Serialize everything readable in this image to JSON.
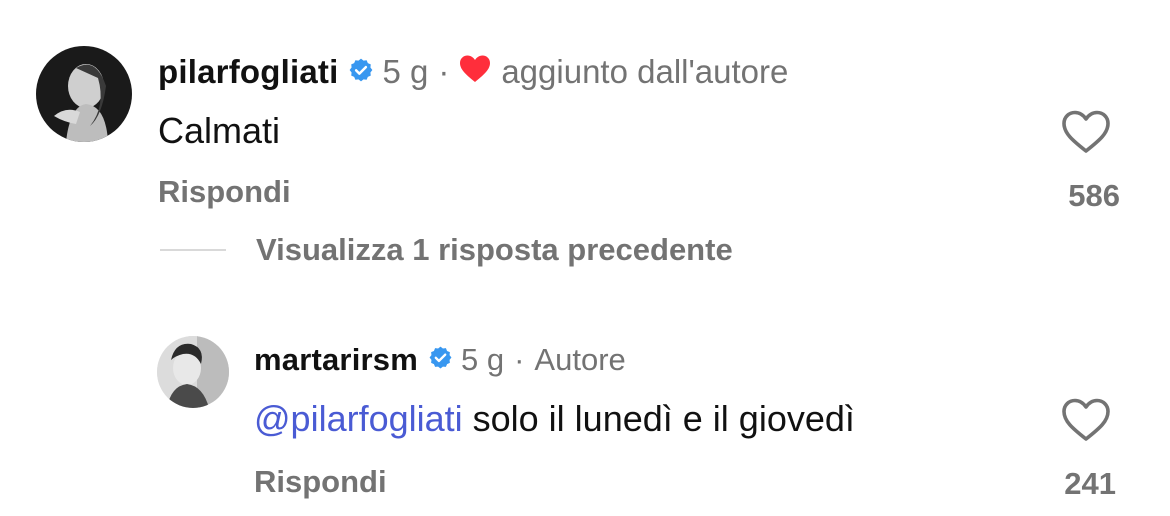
{
  "comments": [
    {
      "username": "pilarfogliati",
      "time": "5 g",
      "liked_by_author_label": "aggiunto dall'autore",
      "text": "Calmati",
      "reply_label": "Rispondi",
      "likes": "586"
    }
  ],
  "view_replies_label": "Visualizza 1 risposta precedente",
  "reply": {
    "username": "martarirsm",
    "time": "5 g",
    "author_badge": "Autore",
    "mention": "@pilarfogliati",
    "text": " solo il lunedì e il giovedì",
    "reply_label": "Rispondi",
    "likes": "241"
  },
  "colors": {
    "verified_blue": "#3897f0",
    "author_heart_red": "#ff2e3b",
    "mention_blue": "#4a5bd4",
    "meta_gray": "#737373"
  },
  "icons": [
    "verified-badge-icon",
    "heart-filled-icon",
    "heart-outline-icon"
  ]
}
